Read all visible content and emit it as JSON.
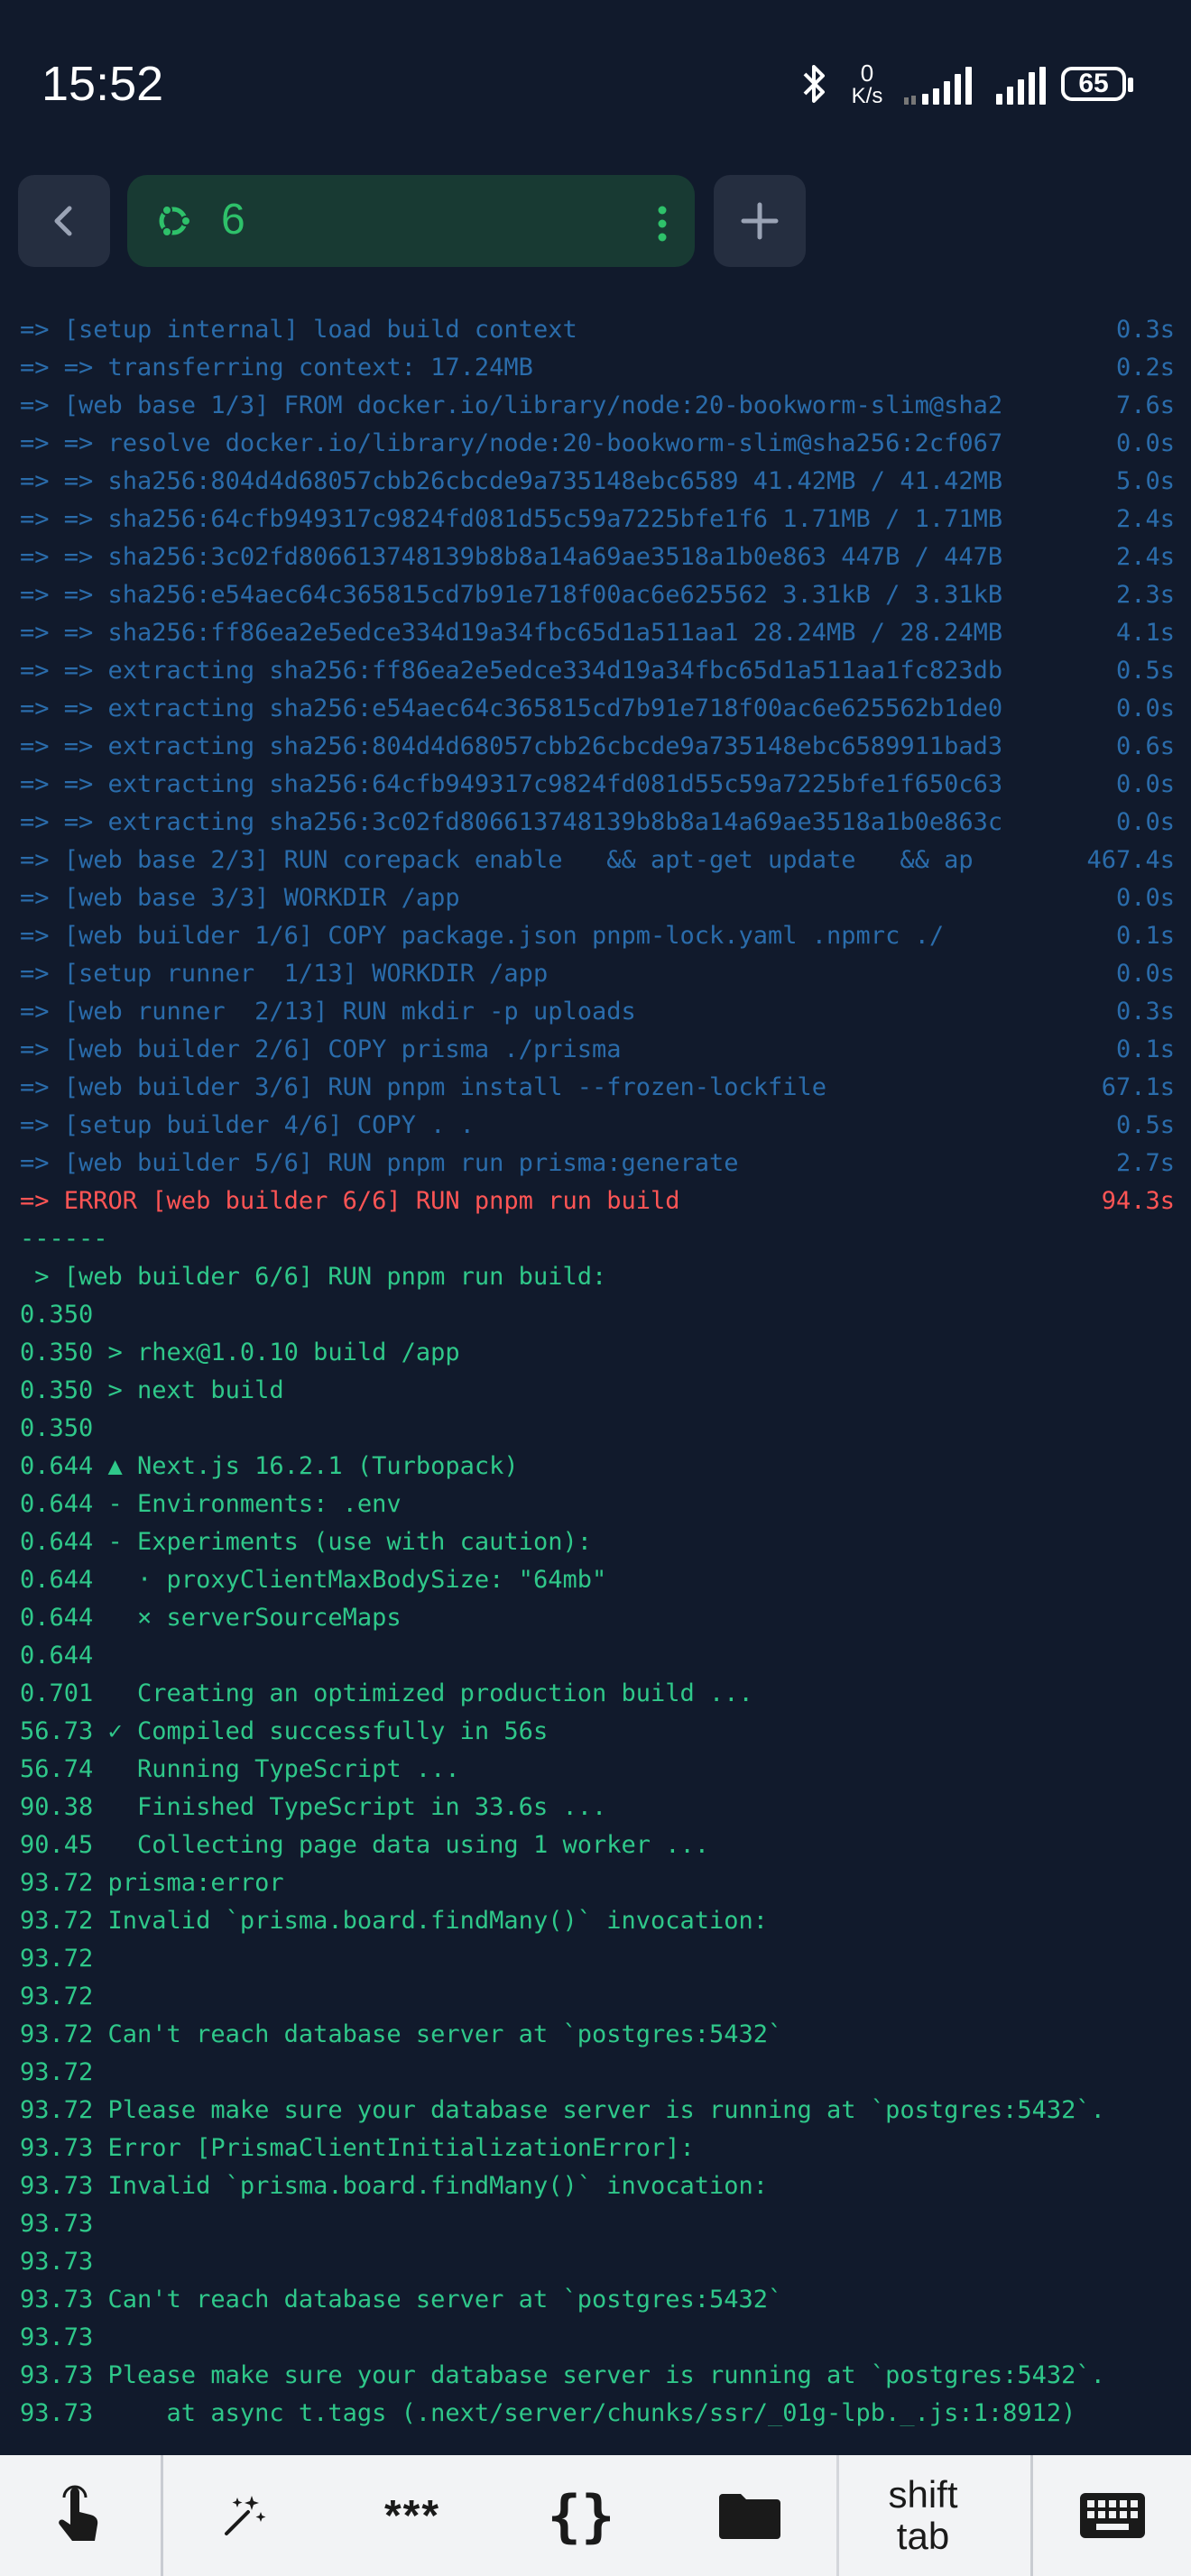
{
  "status_bar": {
    "time": "15:52",
    "net_speed_value": "0",
    "net_speed_unit": "K/s",
    "battery": "65"
  },
  "tabs": {
    "active_label": "6"
  },
  "terminal": {
    "lines": [
      {
        "text": "=> [setup internal] load build context",
        "time": "0.3s",
        "color": "blue"
      },
      {
        "text": "=> => transferring context: 17.24MB",
        "time": "0.2s",
        "color": "blue"
      },
      {
        "text": "=> [web base 1/3] FROM docker.io/library/node:20-bookworm-slim@sha2",
        "time": "7.6s",
        "color": "blue"
      },
      {
        "text": "=> => resolve docker.io/library/node:20-bookworm-slim@sha256:2cf067",
        "time": "0.0s",
        "color": "blue"
      },
      {
        "text": "=> => sha256:804d4d68057cbb26cbcde9a735148ebc6589 41.42MB / 41.42MB",
        "time": "5.0s",
        "color": "blue"
      },
      {
        "text": "=> => sha256:64cfb949317c9824fd081d55c59a7225bfe1f6 1.71MB / 1.71MB",
        "time": "2.4s",
        "color": "blue"
      },
      {
        "text": "=> => sha256:3c02fd806613748139b8b8a14a69ae3518a1b0e863 447B / 447B",
        "time": "2.4s",
        "color": "blue"
      },
      {
        "text": "=> => sha256:e54aec64c365815cd7b91e718f00ac6e625562 3.31kB / 3.31kB",
        "time": "2.3s",
        "color": "blue"
      },
      {
        "text": "=> => sha256:ff86ea2e5edce334d19a34fbc65d1a511aa1 28.24MB / 28.24MB",
        "time": "4.1s",
        "color": "blue"
      },
      {
        "text": "=> => extracting sha256:ff86ea2e5edce334d19a34fbc65d1a511aa1fc823db",
        "time": "0.5s",
        "color": "blue"
      },
      {
        "text": "=> => extracting sha256:e54aec64c365815cd7b91e718f00ac6e625562b1de0",
        "time": "0.0s",
        "color": "blue"
      },
      {
        "text": "=> => extracting sha256:804d4d68057cbb26cbcde9a735148ebc6589911bad3",
        "time": "0.6s",
        "color": "blue"
      },
      {
        "text": "=> => extracting sha256:64cfb949317c9824fd081d55c59a7225bfe1f650c63",
        "time": "0.0s",
        "color": "blue"
      },
      {
        "text": "=> => extracting sha256:3c02fd806613748139b8b8a14a69ae3518a1b0e863c",
        "time": "0.0s",
        "color": "blue"
      },
      {
        "text": "=> [web base 2/3] RUN corepack enable   && apt-get update   && ap",
        "time": "467.4s",
        "color": "blue"
      },
      {
        "text": "=> [web base 3/3] WORKDIR /app",
        "time": "0.0s",
        "color": "blue"
      },
      {
        "text": "=> [web builder 1/6] COPY package.json pnpm-lock.yaml .npmrc ./",
        "time": "0.1s",
        "color": "blue"
      },
      {
        "text": "=> [setup runner  1/13] WORKDIR /app",
        "time": "0.0s",
        "color": "blue"
      },
      {
        "text": "=> [web runner  2/13] RUN mkdir -p uploads",
        "time": "0.3s",
        "color": "blue"
      },
      {
        "text": "=> [web builder 2/6] COPY prisma ./prisma",
        "time": "0.1s",
        "color": "blue"
      },
      {
        "text": "=> [web builder 3/6] RUN pnpm install --frozen-lockfile",
        "time": "67.1s",
        "color": "blue"
      },
      {
        "text": "=> [setup builder 4/6] COPY . .",
        "time": "0.5s",
        "color": "blue"
      },
      {
        "text": "=> [web builder 5/6] RUN pnpm run prisma:generate",
        "time": "2.7s",
        "color": "blue"
      },
      {
        "text": "=> ERROR [web builder 6/6] RUN pnpm run build",
        "time": "94.3s",
        "color": "red"
      },
      {
        "text": "------",
        "time": "",
        "color": "green"
      },
      {
        "text": " > [web builder 6/6] RUN pnpm run build:",
        "time": "",
        "color": "green"
      },
      {
        "text": "0.350",
        "time": "",
        "color": "green"
      },
      {
        "text": "0.350 > rhex@1.0.10 build /app",
        "time": "",
        "color": "green"
      },
      {
        "text": "0.350 > next build",
        "time": "",
        "color": "green"
      },
      {
        "text": "0.350",
        "time": "",
        "color": "green"
      },
      {
        "text": "0.644 ▲ Next.js 16.2.1 (Turbopack)",
        "time": "",
        "color": "green"
      },
      {
        "text": "0.644 - Environments: .env",
        "time": "",
        "color": "green"
      },
      {
        "text": "0.644 - Experiments (use with caution):",
        "time": "",
        "color": "green"
      },
      {
        "text": "0.644   · proxyClientMaxBodySize: \"64mb\"",
        "time": "",
        "color": "green"
      },
      {
        "text": "0.644   × serverSourceMaps",
        "time": "",
        "color": "green"
      },
      {
        "text": "0.644",
        "time": "",
        "color": "green"
      },
      {
        "text": "0.701   Creating an optimized production build ...",
        "time": "",
        "color": "green"
      },
      {
        "text": "56.73 ✓ Compiled successfully in 56s",
        "time": "",
        "color": "green"
      },
      {
        "text": "56.74   Running TypeScript ...",
        "time": "",
        "color": "green"
      },
      {
        "text": "90.38   Finished TypeScript in 33.6s ...",
        "time": "",
        "color": "green"
      },
      {
        "text": "90.45   Collecting page data using 1 worker ...",
        "time": "",
        "color": "green"
      },
      {
        "text": "93.72 prisma:error",
        "time": "",
        "color": "green"
      },
      {
        "text": "93.72 Invalid `prisma.board.findMany()` invocation:",
        "time": "",
        "color": "green"
      },
      {
        "text": "93.72",
        "time": "",
        "color": "green"
      },
      {
        "text": "93.72",
        "time": "",
        "color": "green"
      },
      {
        "text": "93.72 Can't reach database server at `postgres:5432`",
        "time": "",
        "color": "green"
      },
      {
        "text": "93.72",
        "time": "",
        "color": "green"
      },
      {
        "text": "93.72 Please make sure your database server is running at `postgres:5432`.",
        "time": "",
        "color": "green"
      },
      {
        "text": "93.73 Error [PrismaClientInitializationError]:",
        "time": "",
        "color": "green"
      },
      {
        "text": "93.73 Invalid `prisma.board.findMany()` invocation:",
        "time": "",
        "color": "green"
      },
      {
        "text": "93.73",
        "time": "",
        "color": "green"
      },
      {
        "text": "93.73",
        "time": "",
        "color": "green"
      },
      {
        "text": "93.73 Can't reach database server at `postgres:5432`",
        "time": "",
        "color": "green"
      },
      {
        "text": "93.73",
        "time": "",
        "color": "green"
      },
      {
        "text": "93.73 Please make sure your database server is running at `postgres:5432`.",
        "time": "",
        "color": "green"
      },
      {
        "text": "93.73     at async t.tags (.next/server/chunks/ssr/_01g-lpb._.js:1:8912)",
        "time": "",
        "color": "green"
      }
    ]
  },
  "extra_keys": {
    "stars": "***",
    "braces": "{}",
    "shift_tab_line1": "shift",
    "shift_tab_line2": "tab"
  },
  "colors": {
    "background": "#111a2c",
    "log_blue": "#2a6cab",
    "error_red": "#ff5555",
    "output_green": "#2fc88a",
    "tab_active": "#183a33",
    "tab_accent": "#2ec16a"
  }
}
